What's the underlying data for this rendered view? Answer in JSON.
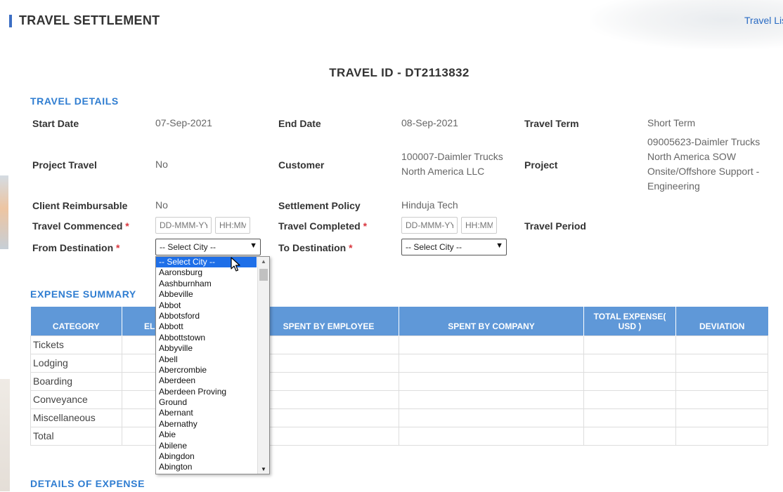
{
  "page": {
    "title": "TRAVEL SETTLEMENT",
    "top_link": "Travel Lis"
  },
  "travel_id": "TRAVEL ID - DT2113832",
  "sections": {
    "travel_details": "TRAVEL DETAILS",
    "expense_summary": "EXPENSE SUMMARY",
    "details_of_expense": "DETAILS OF EXPENSE"
  },
  "details": {
    "start_date_label": "Start Date",
    "start_date": "07-Sep-2021",
    "end_date_label": "End Date",
    "end_date": "08-Sep-2021",
    "travel_term_label": "Travel Term",
    "travel_term": "Short Term",
    "project_travel_label": "Project Travel",
    "project_travel": "No",
    "customer_label": "Customer",
    "customer_line1": "100007-Daimler Trucks",
    "customer_line2": "North America LLC",
    "project_label": "Project",
    "project_line1": "09005623-Daimler Trucks",
    "project_line2": "North America SOW",
    "project_line3": "Onsite/Offshore Support -",
    "project_line4": "Engineering",
    "client_reimbursable_label": "Client Reimbursable",
    "client_reimbursable": "No",
    "settlement_policy_label": "Settlement Policy",
    "settlement_policy": "Hinduja Tech",
    "travel_commenced_label": "Travel Commenced",
    "travel_completed_label": "Travel Completed",
    "travel_period_label": "Travel Period",
    "from_destination_label": "From Destination",
    "to_destination_label": "To Destination",
    "required_mark": "*",
    "date_placeholder": "DD-MMM-YY",
    "time_placeholder": "HH:MM",
    "from_city_value": "-- Select City --",
    "to_city_value": "-- Select City --"
  },
  "expense_table": {
    "headers": [
      "CATEGORY",
      "ELI",
      "SPENT BY EMPLOYEE",
      "SPENT BY COMPANY",
      "TOTAL EXPENSE( USD )",
      "DEVIATION"
    ],
    "rows": [
      "Tickets",
      "Lodging",
      "Boarding",
      "Conveyance",
      "Miscellaneous",
      "Total"
    ]
  },
  "city_dropdown": {
    "options": [
      "-- Select City --",
      "Aaronsburg",
      "Aashburnham",
      "Abbeville",
      "Abbot",
      "Abbotsford",
      "Abbott",
      "Abbottstown",
      "Abbyville",
      "Abell",
      "Abercrombie",
      "Aberdeen",
      "Aberdeen Proving",
      "Ground",
      "Abernant",
      "Abernathy",
      "Abie",
      "Abilene",
      "Abingdon",
      "Abington"
    ],
    "selected_index": 0
  },
  "icons": {
    "select_arrow": "chevron-down-icon",
    "cursor": "mouse-pointer-icon",
    "scroll_up": "scroll-up-icon",
    "scroll_down": "scroll-down-icon"
  },
  "colors": {
    "accent": "#2f7dd1",
    "table_header": "#5f98d8",
    "highlight": "#1e6fe8",
    "required": "#d9363e"
  }
}
